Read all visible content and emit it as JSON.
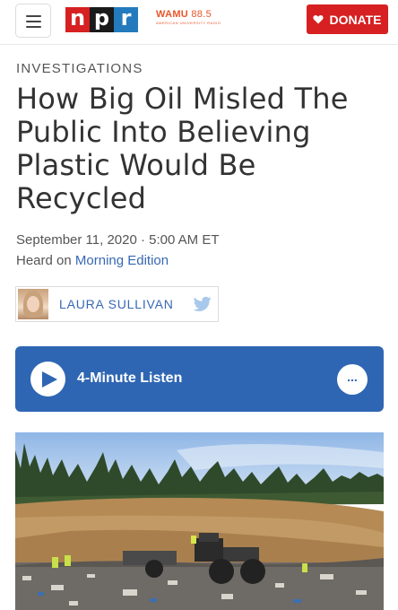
{
  "header": {
    "logo_letters": [
      "n",
      "p",
      "r"
    ],
    "station_name": "WAMU",
    "station_freq": "88.5",
    "station_tagline": "AMERICAN UNIVERSITY RADIO",
    "donate_label": "DONATE"
  },
  "article": {
    "section": "INVESTIGATIONS",
    "headline": "How Big Oil Misled The Public Into Believing Plastic Would Be Recycled",
    "dateline": "September 11, 2020 · 5:00 AM ET",
    "heard_on_prefix": "Heard on",
    "heard_on_program": "Morning Edition",
    "author": "LAURA SULLIVAN"
  },
  "audio": {
    "listen_label": "4-Minute Listen",
    "more_label": "..."
  },
  "icons": {
    "menu": "hamburger-menu-icon",
    "heart": "heart-icon",
    "twitter": "twitter-icon",
    "play": "play-icon",
    "more": "more-options-icon"
  },
  "colors": {
    "npr_red": "#d62021",
    "npr_black": "#1a1a1a",
    "npr_blue": "#237bbd",
    "station_orange": "#e8562b",
    "donate_red": "#d62021",
    "link_blue": "#3768b3",
    "audio_blue": "#2f66b3"
  }
}
